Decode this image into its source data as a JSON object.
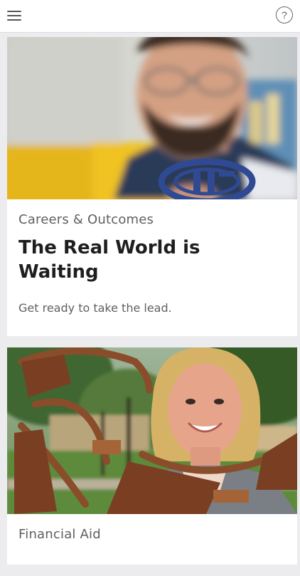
{
  "header": {
    "menu_icon": "hamburger-menu-icon",
    "help_icon": "question-circle-icon",
    "help_glyph": "?"
  },
  "cards": [
    {
      "image_description": "smiling-man-with-glasses-holding-logo",
      "category": "Careers & Outcomes",
      "title": "The Real World is Waiting",
      "subtitle": "Get ready to take the lead."
    },
    {
      "image_description": "smiling-woman-with-sculpture",
      "category": "Financial Aid"
    }
  ],
  "colors": {
    "background": "#ececef",
    "card": "#ffffff",
    "title": "#1e1e1e",
    "muted_text": "#5f5f5f"
  }
}
